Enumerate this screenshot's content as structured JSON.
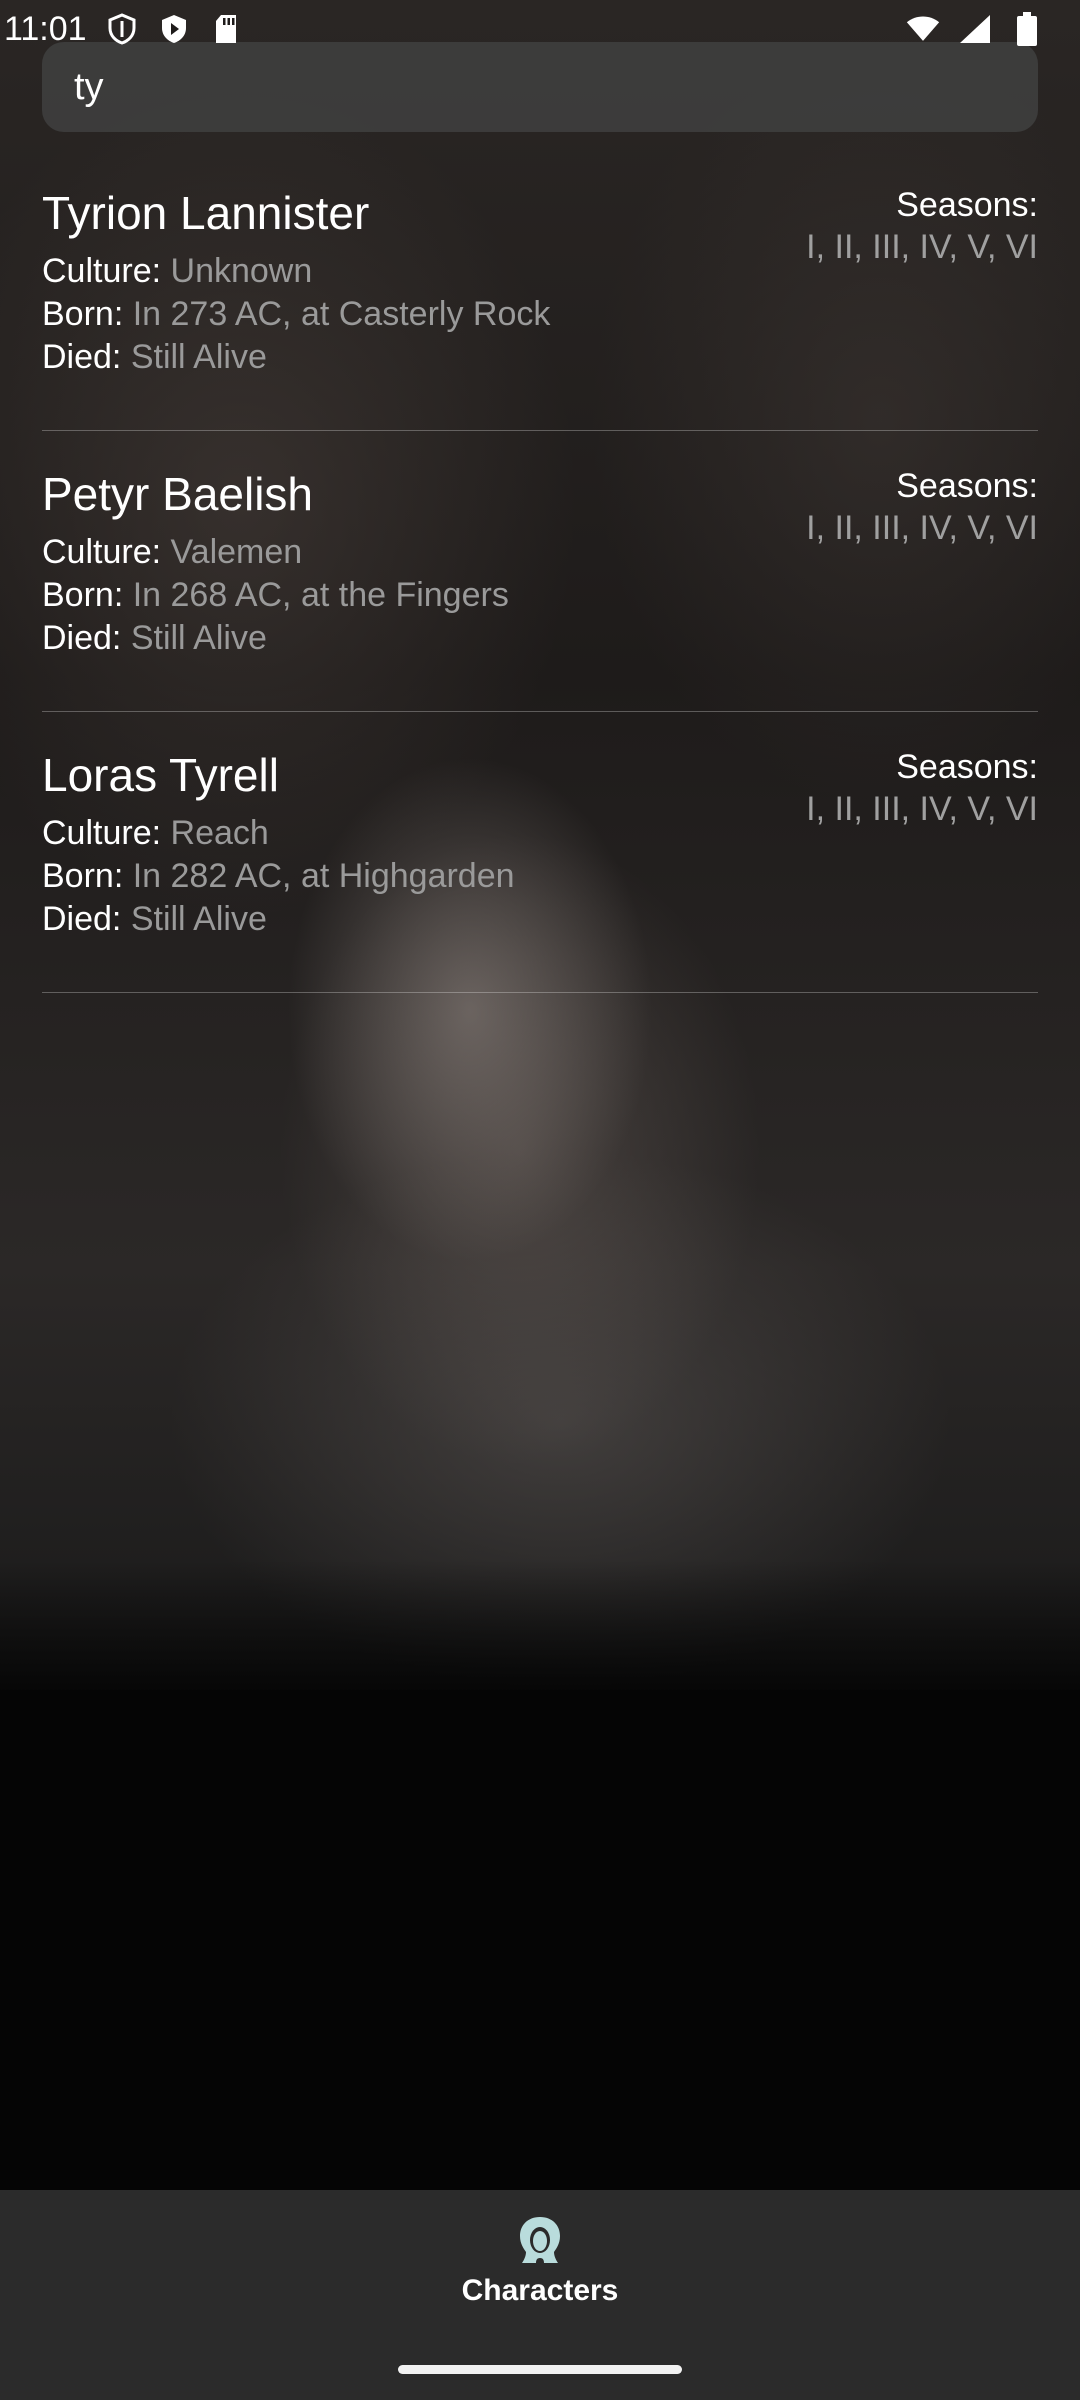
{
  "status_bar": {
    "time": "11:01",
    "icons_left": [
      "shield-icon",
      "play-protect-icon",
      "sd-card-icon"
    ],
    "icons_right": [
      "wifi-icon",
      "cell-signal-icon",
      "battery-icon"
    ]
  },
  "search": {
    "value": "ty"
  },
  "labels": {
    "culture": "Culture:",
    "born": "Born:",
    "died": "Died:",
    "seasons": "Seasons:"
  },
  "characters": [
    {
      "name": "Tyrion Lannister",
      "culture": "Unknown",
      "born": "In 273 AC, at Casterly Rock",
      "died": "Still Alive",
      "seasons": "I, II, III, IV, V, VI"
    },
    {
      "name": "Petyr Baelish",
      "culture": "Valemen",
      "born": "In 268 AC, at the Fingers",
      "died": "Still Alive",
      "seasons": "I, II, III, IV, V, VI"
    },
    {
      "name": "Loras Tyrell",
      "culture": "Reach",
      "born": "In 282 AC, at Highgarden",
      "died": "Still Alive",
      "seasons": "I, II, III, IV, V, VI"
    }
  ],
  "bottom_nav": {
    "items": [
      {
        "label": "Characters",
        "icon": "characters-head-icon",
        "active": true
      }
    ]
  },
  "colors": {
    "nav_icon": "#b9dcdc",
    "value_text": "#9a9a9a",
    "search_bg": "#3e3e3e",
    "nav_bg": "#2b2b2b"
  }
}
